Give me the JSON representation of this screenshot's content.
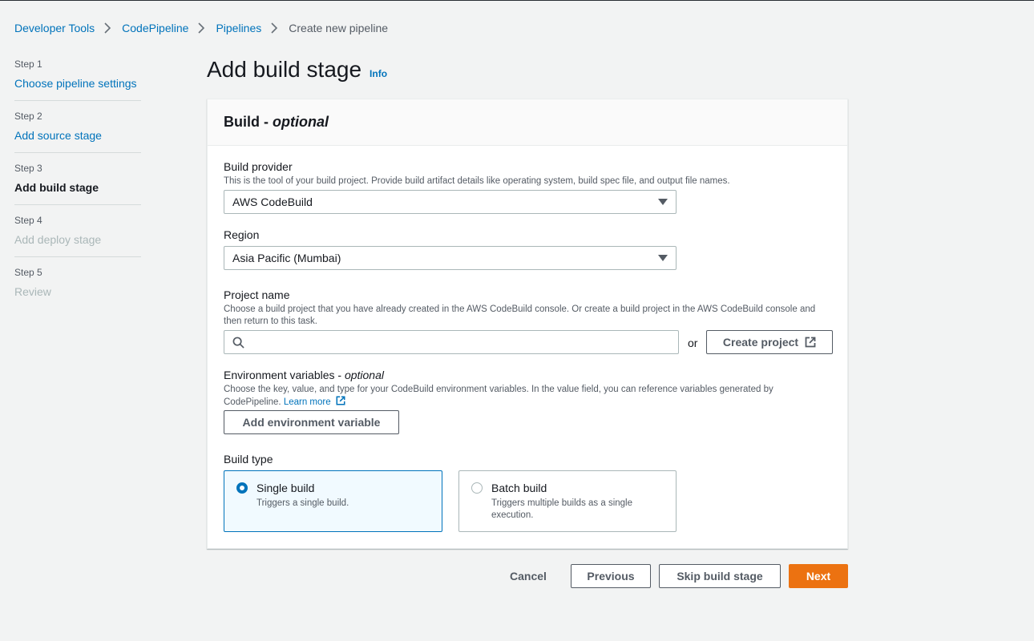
{
  "breadcrumb": {
    "items": [
      "Developer Tools",
      "CodePipeline",
      "Pipelines"
    ],
    "current": "Create new pipeline"
  },
  "steps": [
    {
      "num": "Step 1",
      "label": "Choose pipeline settings",
      "state": "link"
    },
    {
      "num": "Step 2",
      "label": "Add source stage",
      "state": "link"
    },
    {
      "num": "Step 3",
      "label": "Add build stage",
      "state": "active"
    },
    {
      "num": "Step 4",
      "label": "Add deploy stage",
      "state": "disabled"
    },
    {
      "num": "Step 5",
      "label": "Review",
      "state": "disabled"
    }
  ],
  "page": {
    "title": "Add build stage",
    "info": "Info"
  },
  "panel": {
    "title": "Build - ",
    "title_optional": "optional"
  },
  "build_provider": {
    "label": "Build provider",
    "desc": "This is the tool of your build project. Provide build artifact details like operating system, build spec file, and output file names.",
    "value": "AWS CodeBuild"
  },
  "region": {
    "label": "Region",
    "value": "Asia Pacific (Mumbai)"
  },
  "project": {
    "label": "Project name",
    "desc": "Choose a build project that you have already created in the AWS CodeBuild console. Or create a build project in the AWS CodeBuild console and then return to this task.",
    "value": "",
    "or": "or",
    "create_label": "Create project"
  },
  "env_vars": {
    "label": "Environment variables - ",
    "label_optional": "optional",
    "desc": "Choose the key, value, and type for your CodeBuild environment variables. In the value field, you can reference variables generated by CodePipeline. ",
    "learn_more": "Learn more",
    "add_label": "Add environment variable"
  },
  "build_type": {
    "label": "Build type",
    "options": [
      {
        "title": "Single build",
        "desc": "Triggers a single build.",
        "selected": true
      },
      {
        "title": "Batch build",
        "desc": "Triggers multiple builds as a single execution.",
        "selected": false
      }
    ]
  },
  "footer": {
    "cancel": "Cancel",
    "previous": "Previous",
    "skip": "Skip build stage",
    "next": "Next"
  },
  "colors": {
    "link": "#0073bb",
    "primary": "#ec7211",
    "selected_bg": "#f1faff"
  }
}
